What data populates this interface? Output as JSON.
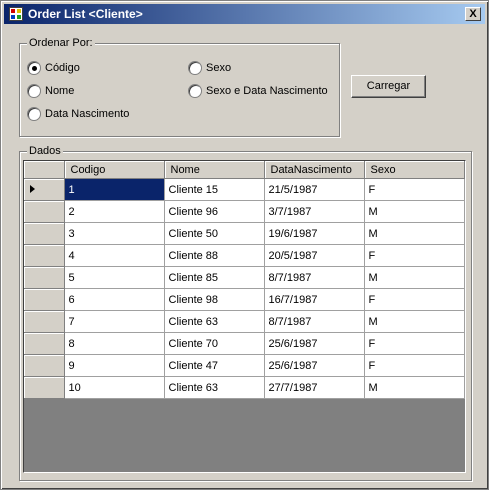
{
  "window": {
    "title": "Order List <Cliente>",
    "close_label": "X"
  },
  "order_group": {
    "legend": "Ordenar Por:",
    "options": [
      {
        "label": "Código",
        "checked": true
      },
      {
        "label": "Nome",
        "checked": false
      },
      {
        "label": "Data Nascimento",
        "checked": false
      },
      {
        "label": "Sexo",
        "checked": false
      },
      {
        "label": "Sexo e Data Nascimento",
        "checked": false
      }
    ]
  },
  "load_button": {
    "label": "Carregar"
  },
  "data_group": {
    "legend": "Dados",
    "columns": [
      "Codigo",
      "Nome",
      "DataNascimento",
      "Sexo"
    ],
    "rows": [
      [
        "1",
        "Cliente 15",
        "21/5/1987",
        "F"
      ],
      [
        "2",
        "Cliente 96",
        "3/7/1987",
        "M"
      ],
      [
        "3",
        "Cliente 50",
        "19/6/1987",
        "M"
      ],
      [
        "4",
        "Cliente 88",
        "20/5/1987",
        "F"
      ],
      [
        "5",
        "Cliente 85",
        "8/7/1987",
        "M"
      ],
      [
        "6",
        "Cliente 98",
        "16/7/1987",
        "F"
      ],
      [
        "7",
        "Cliente 63",
        "8/7/1987",
        "M"
      ],
      [
        "8",
        "Cliente 70",
        "25/6/1987",
        "F"
      ],
      [
        "9",
        "Cliente 47",
        "25/6/1987",
        "F"
      ],
      [
        "10",
        "Cliente 63",
        "27/7/1987",
        "M"
      ]
    ]
  },
  "colors": {
    "titlebar_start": "#0a246a",
    "titlebar_end": "#a6caf0",
    "selection": "#0a246a",
    "window_bg": "#d4d0c8",
    "grid_bg": "#808080"
  }
}
